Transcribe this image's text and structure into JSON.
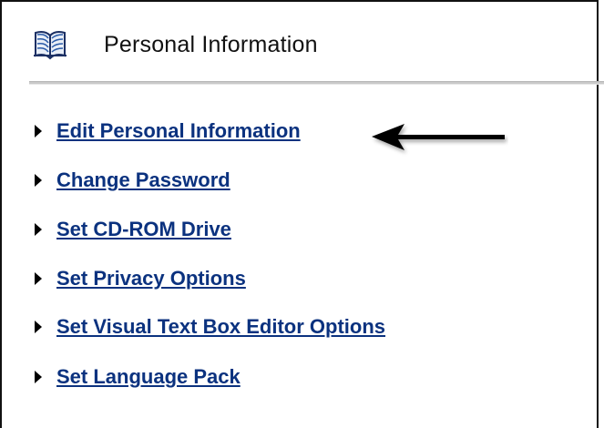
{
  "panel": {
    "title": "Personal Information",
    "title_icon": "book-icon"
  },
  "menu": {
    "bullet_icon": "triangle-right-icon",
    "items": [
      {
        "id": "edit-personal-information",
        "label": "Edit Personal Information"
      },
      {
        "id": "change-password",
        "label": "Change Password"
      },
      {
        "id": "set-cd-rom-drive",
        "label": "Set CD-ROM Drive"
      },
      {
        "id": "set-privacy-options",
        "label": "Set Privacy Options"
      },
      {
        "id": "set-visual-text-box-editor-options",
        "label": "Set Visual Text Box Editor Options"
      },
      {
        "id": "set-language-pack",
        "label": "Set Language Pack"
      }
    ]
  },
  "annotation": {
    "icon": "left-arrow-icon",
    "target": "edit-personal-information"
  },
  "colors": {
    "link": "#0b327f",
    "title": "#111111",
    "divider": "#c9c9c9"
  }
}
